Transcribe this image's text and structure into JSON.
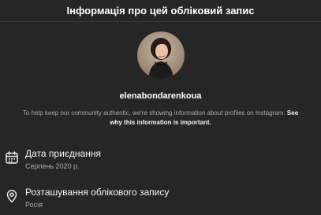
{
  "header": {
    "title": "Інформація про цей обліковий запис"
  },
  "profile": {
    "username": "elenabondarenkoua"
  },
  "disclaimer": {
    "text": "To help keep our community authentic, we're showing information about profiles on Instagram. ",
    "link": "See why this information is important."
  },
  "details": {
    "joined": {
      "label": "Дата приєднання",
      "value": "Серпень 2020 р.",
      "icon": "calendar-icon"
    },
    "location": {
      "label": "Розташування облікового запису",
      "value": "Росія",
      "icon": "location-pin-icon"
    }
  },
  "colors": {
    "background": "#262626",
    "text_primary": "#f5f5f5",
    "text_secondary": "#a8a8a8"
  }
}
